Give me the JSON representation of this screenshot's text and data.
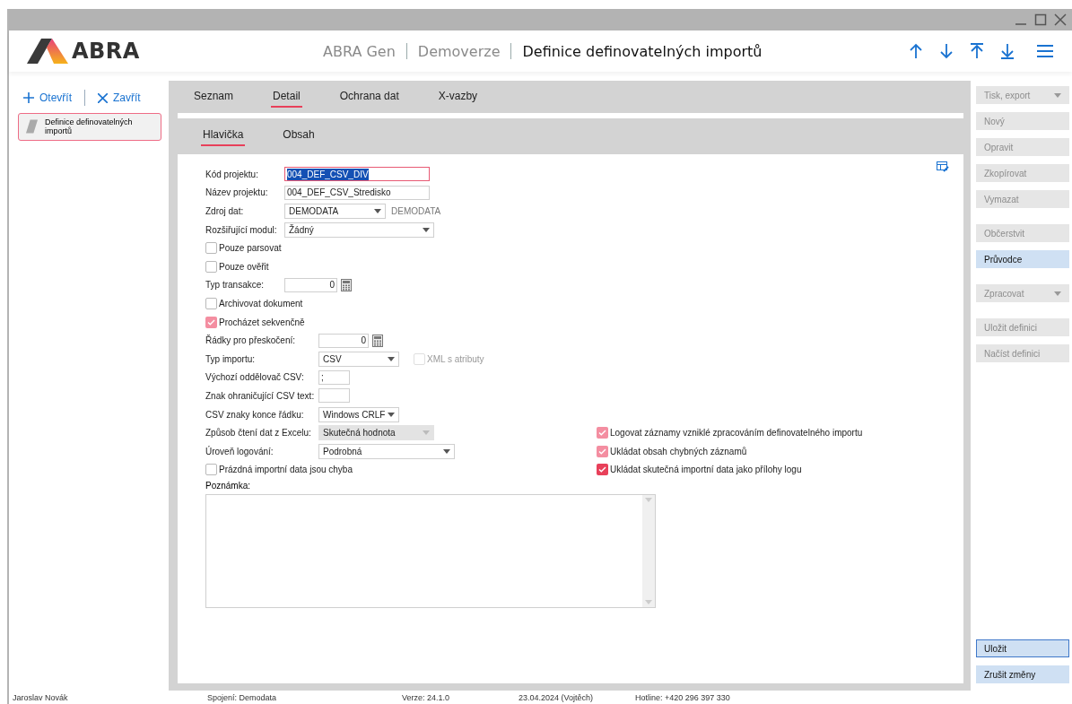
{
  "header": {
    "logo": "ABRA",
    "breadcrumbs": [
      "ABRA Gen",
      "Demoverze"
    ],
    "title": "Definice definovatelných importů"
  },
  "sidebar": {
    "actions": [
      {
        "kind": "open",
        "label": "Otevřít"
      },
      {
        "kind": "close",
        "label": "Zavřít"
      }
    ],
    "items": [
      {
        "label": "Definice definovatelných importů",
        "selected": true
      }
    ]
  },
  "tabs": [
    {
      "label": "Seznam",
      "selected": false
    },
    {
      "label": "Detail",
      "selected": true
    },
    {
      "label": "Ochrana dat",
      "selected": false
    },
    {
      "label": "X-vazby",
      "selected": false
    }
  ],
  "subtabs": [
    {
      "label": "Hlavička",
      "selected": true
    },
    {
      "label": "Obsah",
      "selected": false
    }
  ],
  "form": {
    "general": [
      {
        "kind": "text",
        "label": "Kód projektu:",
        "value": "004_DEF_CSV_DIV",
        "focused": true
      },
      {
        "kind": "text",
        "label": "Název projektu:",
        "value": "004_DEF_CSV_Stredisko",
        "focused": false
      },
      {
        "kind": "select",
        "label": "Zdroj dat:",
        "value": "DEMODATA",
        "disabled": false,
        "hint": "DEMODATA"
      },
      {
        "kind": "select",
        "label": "Rozšiřující modul:",
        "value": "Žádný",
        "disabled": false
      },
      {
        "kind": "checkbox",
        "label": "Pouze parsovat",
        "checked": false,
        "disabled": false
      },
      {
        "kind": "checkbox",
        "label": "Pouze ověřit",
        "checked": false,
        "disabled": false
      },
      {
        "kind": "number",
        "label": "Typ transakce:",
        "value": "0"
      },
      {
        "kind": "checkbox",
        "label": "Archivovat dokument",
        "checked": false,
        "disabled": false
      },
      {
        "kind": "checkbox",
        "label": "Procházet sekvenčně",
        "checked": true,
        "disabled": true
      }
    ],
    "import_settings": [
      {
        "kind": "number",
        "label": "Řádky pro přeskočení:",
        "value": "0"
      },
      {
        "kind": "select",
        "label": "Typ importu:",
        "value": "CSV",
        "disabled": false,
        "option": {
          "label": "XML s atributy",
          "checked": false,
          "disabled": true
        }
      },
      {
        "kind": "text",
        "label": "Výchozí oddělovač CSV:",
        "value": ";",
        "focused": false
      },
      {
        "kind": "text",
        "label": "Znak ohraničující CSV text:",
        "focused": false
      },
      {
        "kind": "select",
        "label": "CSV znaky konce řádku:",
        "value": "Windows CRLF",
        "disabled": false
      },
      {
        "kind": "select",
        "label": "Způsob čtení dat z Excelu:",
        "value": "Skutečná hodnota",
        "disabled": true,
        "aside": {
          "label": "Logovat záznamy vzniklé zpracováním definovatelného importu",
          "checked": true,
          "disabled": true
        }
      },
      {
        "kind": "select",
        "label": "Úroveň logování:",
        "value": "Podrobná",
        "disabled": false,
        "aside": {
          "label": "Ukládat obsah chybných záznamů",
          "checked": true,
          "disabled": true
        }
      },
      {
        "kind": "checkbox",
        "label": "Prázdná importní data jsou chyba",
        "checked": false,
        "disabled": false,
        "aside": {
          "label": "Ukládat skutečná importní data jako přílohy logu",
          "checked": true,
          "disabled": false
        }
      }
    ],
    "note": {
      "label": "Poznámka:"
    }
  },
  "actions": {
    "groups": [
      [
        {
          "label": "Tisk, export",
          "disabled": true,
          "dropdown": true,
          "focused": false
        },
        {
          "label": "Nový",
          "disabled": true,
          "dropdown": false,
          "focused": false
        },
        {
          "label": "Opravit",
          "disabled": true,
          "dropdown": false,
          "focused": false
        },
        {
          "label": "Zkopírovat",
          "disabled": true,
          "dropdown": false,
          "focused": false
        },
        {
          "label": "Vymazat",
          "disabled": true,
          "dropdown": false,
          "focused": false
        }
      ],
      [
        {
          "label": "Občerstvit",
          "disabled": true,
          "dropdown": false,
          "focused": false
        },
        {
          "label": "Průvodce",
          "disabled": false,
          "dropdown": false,
          "focused": false
        }
      ],
      [
        {
          "label": "Zpracovat",
          "disabled": true,
          "dropdown": true,
          "focused": false
        }
      ],
      [
        {
          "label": "Uložit definici",
          "disabled": true,
          "dropdown": false,
          "focused": false
        },
        {
          "label": "Načíst definici",
          "disabled": true,
          "dropdown": false,
          "focused": false
        }
      ]
    ],
    "footer": [
      {
        "label": "Uložit",
        "disabled": false,
        "dropdown": false,
        "focused": true
      },
      {
        "label": "Zrušit změny",
        "disabled": false,
        "dropdown": false,
        "focused": false
      }
    ]
  },
  "status_bar": [
    "Jaroslav Novák",
    "Spojení: Demodata",
    "Verze: 24.1.0",
    "23.04.2024 (Vojtěch)",
    "Hotline: +420 296 397 330"
  ]
}
